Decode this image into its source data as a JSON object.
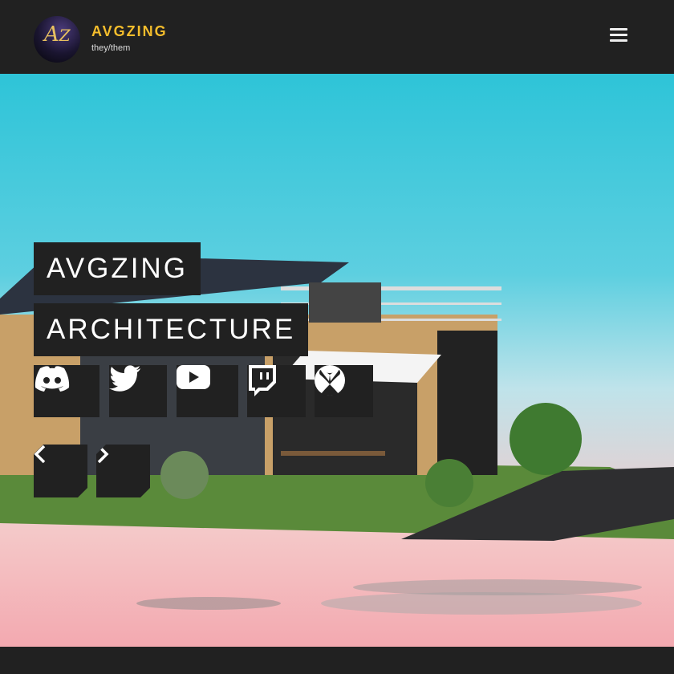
{
  "header": {
    "logo_text": "AZ",
    "brand": "AVGZING",
    "pronouns": "they/them",
    "menu_icon": "hamburger-icon"
  },
  "hero": {
    "title_line1": "AVGZING",
    "title_line2": "ARCHITECTURE",
    "social": [
      {
        "name": "discord",
        "icon": "discord-icon"
      },
      {
        "name": "twitter",
        "icon": "twitter-icon"
      },
      {
        "name": "youtube",
        "icon": "youtube-icon"
      },
      {
        "name": "twitch",
        "icon": "twitch-icon"
      },
      {
        "name": "xbox",
        "icon": "xbox-icon"
      }
    ],
    "prev_icon": "chevron-left-icon",
    "next_icon": "chevron-right-icon"
  },
  "colors": {
    "bar": "#212121",
    "accent": "#f4bd2c"
  }
}
